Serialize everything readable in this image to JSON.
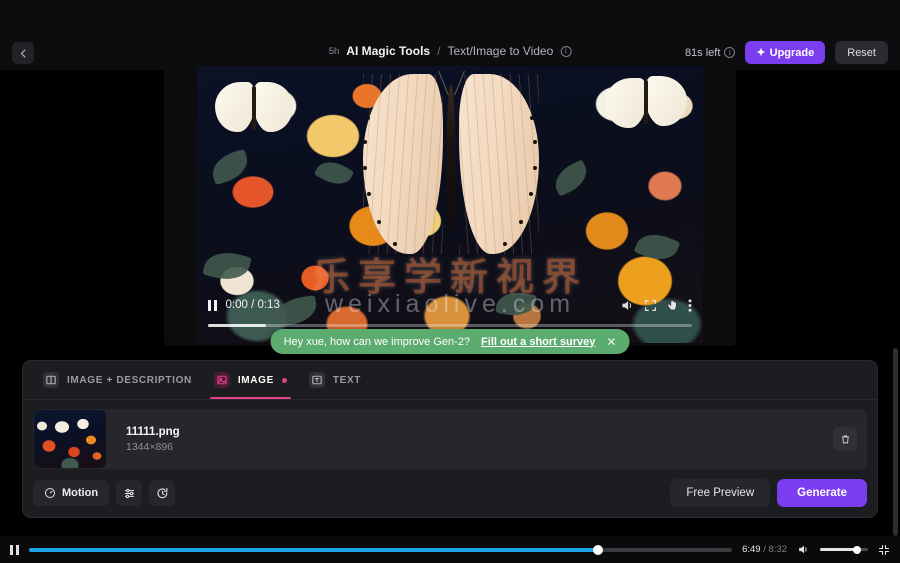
{
  "header": {
    "back_icon": "arrow-left-icon",
    "badge": "5h",
    "title": "AI Magic Tools",
    "separator": "/",
    "subtitle": "Text/Image to Video",
    "subtitle_info_icon": "info-icon",
    "time_left": "81s left",
    "time_left_info_icon": "info-icon",
    "upgrade_label": "Upgrade",
    "upgrade_icon": "sparkle-icon",
    "reset_label": "Reset",
    "accent_purple": "#7a3df0"
  },
  "video": {
    "watermark_cn": "乐享学新视界",
    "watermark_en": "weixiaolive.com",
    "current_time": "0:00",
    "duration": "0:13",
    "time_display": "0:00 / 0:13",
    "pause_icon": "pause-icon",
    "volume_icon": "volume-icon",
    "fullscreen_icon": "fullscreen-icon",
    "cursor_icon": "hand-cursor-icon",
    "more_icon": "more-vertical-icon",
    "progress_percent": 12
  },
  "toast": {
    "message": "Hey xue, how can we improve Gen-2?",
    "link_label": "Fill out a short survey",
    "close_icon": "close-icon",
    "background": "#5cab6f"
  },
  "panel": {
    "tabs": [
      {
        "label": "IMAGE + DESCRIPTION",
        "icon": "columns-icon",
        "active": false,
        "dot": false
      },
      {
        "label": "IMAGE",
        "icon": "image-icon",
        "active": true,
        "dot": true
      },
      {
        "label": "TEXT",
        "icon": "text-icon",
        "active": false,
        "dot": false
      }
    ],
    "active_tab_color": "#e2438b",
    "file": {
      "name": "11111.png",
      "dimensions": "1344×896",
      "thumbnail_name": "uploaded-image-thumbnail",
      "delete_icon": "trash-icon"
    },
    "controls": [
      {
        "label": "Motion",
        "icon": "gauge-icon",
        "name": "motion-button"
      },
      {
        "label": "",
        "icon": "sliders-icon",
        "name": "settings-button"
      },
      {
        "label": "",
        "icon": "timer-icon",
        "name": "timer-button"
      }
    ],
    "free_preview_label": "Free Preview",
    "generate_label": "Generate"
  },
  "playerbar": {
    "pause_icon": "pause-icon",
    "current_time": "6:49",
    "separator": "/",
    "duration": "8:32",
    "volume_icon": "volume-icon",
    "fullscreen_icon": "fullscreen-exit-icon",
    "progress_percent": 81,
    "volume_percent": 78,
    "progress_color": "#1ea2e8"
  }
}
